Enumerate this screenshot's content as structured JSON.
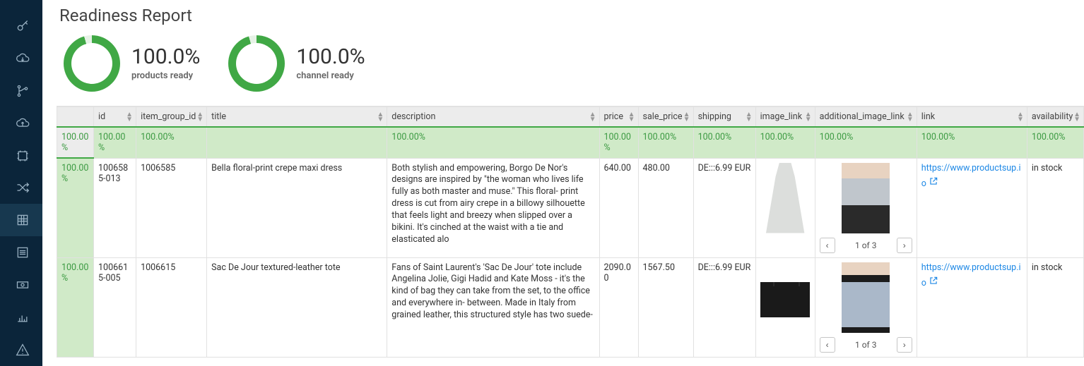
{
  "page_title": "Readiness Report",
  "gauges": [
    {
      "value": "100.0%",
      "label": "products ready"
    },
    {
      "value": "100.0%",
      "label": "channel ready"
    }
  ],
  "columns": [
    "id",
    "item_group_id",
    "title",
    "description",
    "price",
    "sale_price",
    "shipping",
    "image_link",
    "additional_image_link",
    "link",
    "availability"
  ],
  "pct_row": [
    "100.00%",
    "100.00%",
    "100.00%",
    "",
    "100.00%",
    "100.00%",
    "100.00%",
    "100.00%",
    "100.00%",
    "100.00%",
    "100.00%",
    "100.00%"
  ],
  "rows": [
    {
      "rowpct": "100.00%",
      "id": "1006585-013",
      "item_group_id": "1006585",
      "title": "Bella floral-print crepe maxi dress",
      "description": "Both stylish and empowering, Borgo De Nor's designs are inspired by \"the woman who lives life fully as both master and muse.\" This floral-\nprint dress is cut from airy crepe in a billowy silhouette that feels light and breezy when slipped over a bikini. It's cinched at the waist with a tie and elasticated alo",
      "price": "640.00",
      "sale_price": "480.00",
      "shipping": "DE:::6.99 EUR",
      "link": "https://www.productsup.io",
      "availability": "in stock",
      "pager": "1 of 3",
      "image_kind": "dress",
      "addl_image_kind": "person"
    },
    {
      "rowpct": "100.00%",
      "id": "1006615-005",
      "item_group_id": "1006615",
      "title": "Sac De Jour textured-leather tote",
      "description": "Fans of Saint Laurent's 'Sac De Jour' tote include Angelina Jolie, Gigi Hadid and Kate Moss - it's the kind of bag they can take from the set, to the office and everywhere in-\nbetween. Made in Italy from grained leather, this structured style has two suede-",
      "price": "2090.00",
      "sale_price": "1567.50",
      "shipping": "DE:::6.99 EUR",
      "link": "https://www.productsup.io",
      "availability": "in stock",
      "pager": "1 of 3",
      "image_kind": "bag",
      "addl_image_kind": "jeans"
    }
  ],
  "sidebar_icons": [
    "key-icon",
    "cloud-download-icon",
    "branch-icon",
    "cloud-upload-icon",
    "frame-icon",
    "shuffle-icon",
    "grid-icon",
    "list-icon",
    "money-icon",
    "chart-icon",
    "warning-icon"
  ]
}
